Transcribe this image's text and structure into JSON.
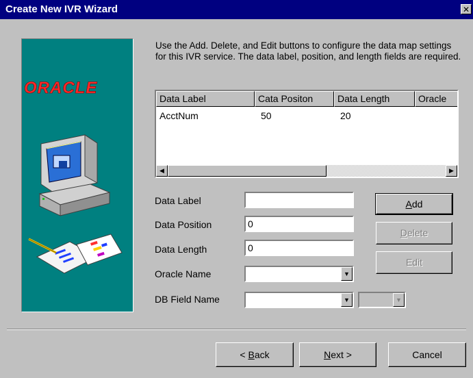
{
  "window": {
    "title": "Create New IVR Wizard",
    "close_glyph": "✕"
  },
  "art": {
    "logo_text": "ORACLE"
  },
  "instructions": "Use the Add. Delete, and Edit buttons to configure the data map settings for this IVR service.  The data label, position, and length fields are required.",
  "list": {
    "columns": [
      "Data Label",
      "Cata Positon",
      "Data Length",
      "Oracle"
    ],
    "rows": [
      {
        "label": "AcctNum",
        "position": "50",
        "length": "20",
        "oracle": ""
      }
    ]
  },
  "form": {
    "data_label": {
      "label": "Data Label",
      "value": ""
    },
    "data_position": {
      "label": "Data Position",
      "value": "0"
    },
    "data_length": {
      "label": "Data Length",
      "value": "0"
    },
    "oracle_name": {
      "label": "Oracle Name",
      "value": ""
    },
    "db_field_name": {
      "label": "DB Field Name",
      "value": ""
    }
  },
  "buttons": {
    "add": {
      "u": "A",
      "rest": "dd"
    },
    "delete": {
      "u": "D",
      "rest": "elete"
    },
    "edit": {
      "u": "",
      "rest": "Edit"
    },
    "back": {
      "pre": "< ",
      "u": "B",
      "rest": "ack"
    },
    "next": {
      "u": "N",
      "rest": "ext >"
    },
    "cancel": "Cancel"
  },
  "icons": {
    "close": "close-icon",
    "combo_arrow": "chevron-down-icon",
    "scroll_left": "scroll-left-icon",
    "scroll_right": "scroll-right-icon"
  }
}
